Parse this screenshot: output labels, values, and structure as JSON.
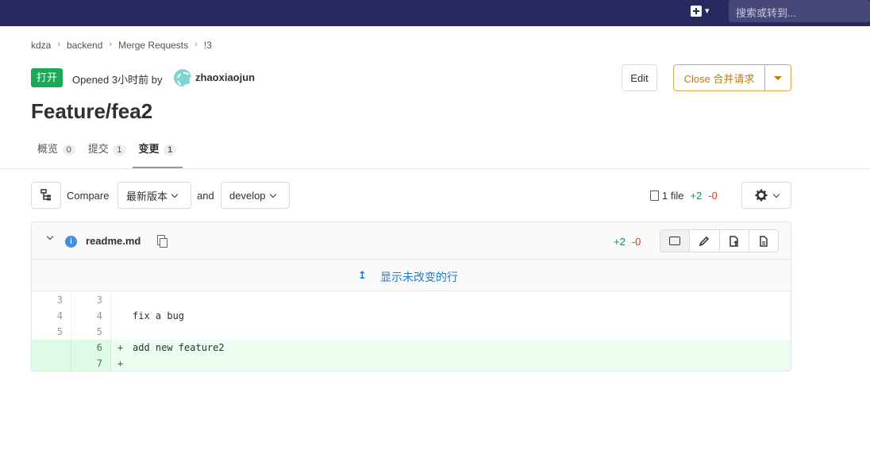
{
  "topbar": {
    "search_placeholder": "搜索或转到..."
  },
  "breadcrumb": [
    "kdza",
    "backend",
    "Merge Requests",
    "!3"
  ],
  "status_badge": "打开",
  "opened_text": "Opened 3小时前 by",
  "author": "zhaoxiaojun",
  "actions": {
    "edit": "Edit",
    "close": "Close 合并请求"
  },
  "title": "Feature/fea2",
  "tabs": [
    {
      "label": "概览",
      "count": "0"
    },
    {
      "label": "提交",
      "count": "1"
    },
    {
      "label": "变更",
      "count": "1"
    }
  ],
  "compare": {
    "label": "Compare",
    "source": "最新版本",
    "and": "and",
    "target": "develop"
  },
  "stats": {
    "files": "1 file",
    "added": "+2",
    "removed": "-0"
  },
  "diff": {
    "filename": "readme.md",
    "added": "+2",
    "removed": "-0",
    "expand_label": "显示未改变的行",
    "lines": [
      {
        "old": "3",
        "new": "3",
        "text": "",
        "type": "context"
      },
      {
        "old": "4",
        "new": "4",
        "text": "fix a bug",
        "type": "context"
      },
      {
        "old": "5",
        "new": "5",
        "text": "",
        "type": "context"
      },
      {
        "old": "",
        "new": "6",
        "text": "add new feature2",
        "type": "added"
      },
      {
        "old": "",
        "new": "7",
        "text": "",
        "type": "added"
      }
    ]
  }
}
